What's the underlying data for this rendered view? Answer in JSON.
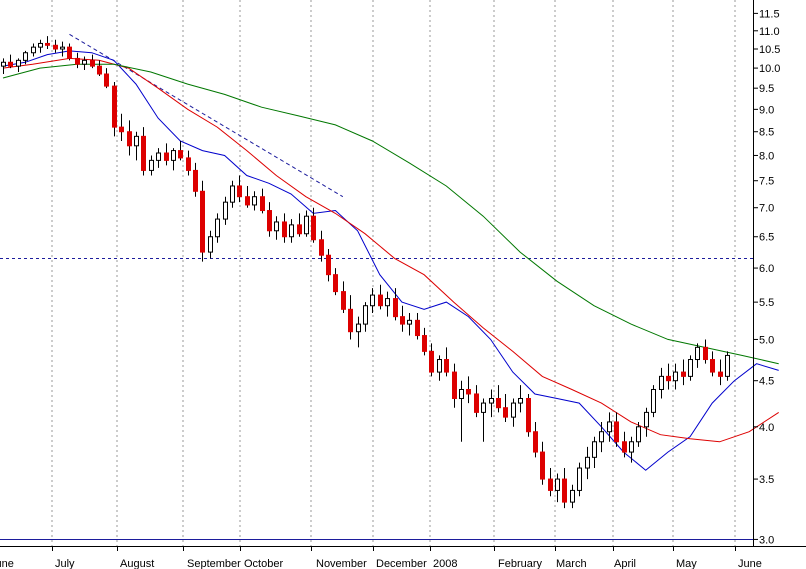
{
  "chart_data": {
    "type": "candlestick",
    "scale": "log",
    "ylim": [
      2.95,
      11.9
    ],
    "x_categories": [
      "June",
      "July",
      "August",
      "September",
      "October",
      "November",
      "December",
      "2008",
      "February",
      "March",
      "April",
      "May",
      "June"
    ],
    "y_ticks": [
      3.0,
      3.5,
      4.0,
      4.5,
      5.0,
      5.5,
      6.0,
      6.5,
      7.0,
      7.5,
      8.0,
      8.5,
      9.0,
      9.5,
      10.0,
      10.5,
      11.0,
      11.5
    ],
    "y_tick_labels": [
      "3.0",
      "3.5",
      "4.0",
      "4.5",
      "5.0",
      "5.5",
      "6.0",
      "6.5",
      "7.0",
      "7.5",
      "8.0",
      "8.5",
      "9.0",
      "9.5",
      "10.0",
      "10.5",
      "11.0",
      "11.5"
    ],
    "grid": "vertical dotted at month boundaries",
    "horizontal_lines": [
      {
        "value": 6.15,
        "style": "dashed",
        "color": "#1c1c9c"
      },
      {
        "value": 3.0,
        "style": "solid",
        "color": "#1c1c9c"
      }
    ],
    "trendline": {
      "style": "dashed",
      "color": "#1c1c9c",
      "from": {
        "day": 9,
        "value": 10.9
      },
      "to": {
        "day": 46,
        "value": 7.2
      }
    },
    "colors": {
      "up": "#ffffff",
      "down": "#dd0000",
      "wick": "#000000",
      "ma_short": "#0000cc",
      "ma_medium": "#dd0000",
      "ma_long": "#007700"
    },
    "series": [
      {
        "style": "line",
        "color": "#0000cc",
        "points": [
          [
            0,
            10.05
          ],
          [
            3,
            10.15
          ],
          [
            6,
            10.35
          ],
          [
            9,
            10.45
          ],
          [
            12,
            10.4
          ],
          [
            15,
            10.2
          ],
          [
            18,
            9.6
          ],
          [
            21,
            8.8
          ],
          [
            24,
            8.3
          ],
          [
            27,
            8.1
          ],
          [
            30,
            8.0
          ],
          [
            33,
            7.6
          ],
          [
            36,
            7.45
          ],
          [
            39,
            7.25
          ],
          [
            42,
            6.9
          ],
          [
            45,
            6.95
          ],
          [
            48,
            6.6
          ],
          [
            51,
            5.9
          ],
          [
            54,
            5.5
          ],
          [
            57,
            5.4
          ],
          [
            60,
            5.5
          ],
          [
            63,
            5.3
          ],
          [
            66,
            5.0
          ],
          [
            69,
            4.6
          ],
          [
            72,
            4.35
          ],
          [
            75,
            4.3
          ],
          [
            78,
            4.25
          ],
          [
            81,
            4.0
          ],
          [
            84,
            3.75
          ],
          [
            87,
            3.58
          ],
          [
            90,
            3.75
          ],
          [
            93,
            3.9
          ],
          [
            96,
            4.25
          ],
          [
            99,
            4.5
          ],
          [
            102,
            4.7
          ],
          [
            105,
            4.62
          ]
        ]
      },
      {
        "style": "line",
        "color": "#dd0000",
        "points": [
          [
            0,
            10.0
          ],
          [
            4,
            10.1
          ],
          [
            9,
            10.25
          ],
          [
            13,
            10.2
          ],
          [
            17,
            10.0
          ],
          [
            21,
            9.5
          ],
          [
            25,
            9.0
          ],
          [
            29,
            8.6
          ],
          [
            33,
            8.1
          ],
          [
            37,
            7.6
          ],
          [
            41,
            7.2
          ],
          [
            45,
            6.9
          ],
          [
            49,
            6.55
          ],
          [
            53,
            6.15
          ],
          [
            57,
            5.9
          ],
          [
            61,
            5.5
          ],
          [
            65,
            5.15
          ],
          [
            69,
            4.85
          ],
          [
            73,
            4.55
          ],
          [
            77,
            4.4
          ],
          [
            81,
            4.25
          ],
          [
            85,
            4.05
          ],
          [
            89,
            3.92
          ],
          [
            93,
            3.88
          ],
          [
            97,
            3.85
          ],
          [
            101,
            3.95
          ],
          [
            105,
            4.15
          ]
        ]
      },
      {
        "style": "line",
        "color": "#007700",
        "points": [
          [
            0,
            9.75
          ],
          [
            5,
            10.0
          ],
          [
            10,
            10.1
          ],
          [
            15,
            10.1
          ],
          [
            20,
            9.9
          ],
          [
            25,
            9.6
          ],
          [
            30,
            9.35
          ],
          [
            35,
            9.05
          ],
          [
            40,
            8.85
          ],
          [
            45,
            8.65
          ],
          [
            50,
            8.3
          ],
          [
            55,
            7.85
          ],
          [
            60,
            7.4
          ],
          [
            65,
            6.85
          ],
          [
            70,
            6.25
          ],
          [
            75,
            5.8
          ],
          [
            80,
            5.45
          ],
          [
            85,
            5.2
          ],
          [
            90,
            5.0
          ],
          [
            95,
            4.9
          ],
          [
            100,
            4.8
          ],
          [
            105,
            4.7
          ]
        ]
      }
    ],
    "candles": [
      [
        10.05,
        10.25,
        9.85,
        10.15
      ],
      [
        10.15,
        10.35,
        10.0,
        10.05
      ],
      [
        10.05,
        10.25,
        9.9,
        10.2
      ],
      [
        10.2,
        10.45,
        10.1,
        10.4
      ],
      [
        10.4,
        10.65,
        10.3,
        10.55
      ],
      [
        10.55,
        10.75,
        10.4,
        10.65
      ],
      [
        10.65,
        10.85,
        10.5,
        10.6
      ],
      [
        10.6,
        10.75,
        10.4,
        10.5
      ],
      [
        10.5,
        10.7,
        10.3,
        10.55
      ],
      [
        10.55,
        10.65,
        10.2,
        10.25
      ],
      [
        10.25,
        10.4,
        10.0,
        10.1
      ],
      [
        10.1,
        10.3,
        9.95,
        10.2
      ],
      [
        10.2,
        10.35,
        10.0,
        10.05
      ],
      [
        10.05,
        10.2,
        9.8,
        9.85
      ],
      [
        9.85,
        10.0,
        9.5,
        9.55
      ],
      [
        9.55,
        9.65,
        8.4,
        8.6
      ],
      [
        8.6,
        8.9,
        8.3,
        8.5
      ],
      [
        8.5,
        8.75,
        8.0,
        8.2
      ],
      [
        8.2,
        8.5,
        7.9,
        8.4
      ],
      [
        8.4,
        8.6,
        7.6,
        7.7
      ],
      [
        7.7,
        8.0,
        7.6,
        7.9
      ],
      [
        7.9,
        8.15,
        7.75,
        8.05
      ],
      [
        8.05,
        8.25,
        7.8,
        7.9
      ],
      [
        7.9,
        8.15,
        7.7,
        8.1
      ],
      [
        8.1,
        8.3,
        7.9,
        7.95
      ],
      [
        7.95,
        8.1,
        7.6,
        7.7
      ],
      [
        7.7,
        7.85,
        7.2,
        7.3
      ],
      [
        7.3,
        7.5,
        6.1,
        6.25
      ],
      [
        6.25,
        6.6,
        6.15,
        6.5
      ],
      [
        6.5,
        6.9,
        6.4,
        6.8
      ],
      [
        6.8,
        7.2,
        6.7,
        7.1
      ],
      [
        7.1,
        7.5,
        7.0,
        7.4
      ],
      [
        7.4,
        7.6,
        7.1,
        7.2
      ],
      [
        7.2,
        7.4,
        7.0,
        7.05
      ],
      [
        7.05,
        7.3,
        6.95,
        7.2
      ],
      [
        7.2,
        7.35,
        6.9,
        6.95
      ],
      [
        6.95,
        7.1,
        6.5,
        6.6
      ],
      [
        6.6,
        6.85,
        6.45,
        6.75
      ],
      [
        6.75,
        6.9,
        6.4,
        6.5
      ],
      [
        6.5,
        6.8,
        6.4,
        6.7
      ],
      [
        6.7,
        6.9,
        6.5,
        6.55
      ],
      [
        6.55,
        6.95,
        6.5,
        6.85
      ],
      [
        6.85,
        7.0,
        6.4,
        6.45
      ],
      [
        6.45,
        6.6,
        6.1,
        6.2
      ],
      [
        6.2,
        6.3,
        5.8,
        5.9
      ],
      [
        5.9,
        6.0,
        5.6,
        5.65
      ],
      [
        5.65,
        5.8,
        5.35,
        5.4
      ],
      [
        5.4,
        5.6,
        5.0,
        5.1
      ],
      [
        5.1,
        5.3,
        4.9,
        5.2
      ],
      [
        5.2,
        5.5,
        5.1,
        5.45
      ],
      [
        5.45,
        5.7,
        5.35,
        5.6
      ],
      [
        5.6,
        5.75,
        5.4,
        5.45
      ],
      [
        5.45,
        5.65,
        5.3,
        5.55
      ],
      [
        5.55,
        5.7,
        5.25,
        5.3
      ],
      [
        5.3,
        5.45,
        5.1,
        5.2
      ],
      [
        5.2,
        5.35,
        5.05,
        5.25
      ],
      [
        5.25,
        5.35,
        5.0,
        5.05
      ],
      [
        5.05,
        5.15,
        4.8,
        4.85
      ],
      [
        4.85,
        4.95,
        4.55,
        4.6
      ],
      [
        4.6,
        4.8,
        4.5,
        4.75
      ],
      [
        4.75,
        4.9,
        4.55,
        4.6
      ],
      [
        4.6,
        4.7,
        4.2,
        4.3
      ],
      [
        4.3,
        4.5,
        3.85,
        4.4
      ],
      [
        4.4,
        4.55,
        4.25,
        4.35
      ],
      [
        4.35,
        4.45,
        4.1,
        4.15
      ],
      [
        4.15,
        4.3,
        3.85,
        4.25
      ],
      [
        4.25,
        4.4,
        4.1,
        4.3
      ],
      [
        4.3,
        4.45,
        4.15,
        4.2
      ],
      [
        4.2,
        4.35,
        4.05,
        4.1
      ],
      [
        4.1,
        4.3,
        4.0,
        4.25
      ],
      [
        4.25,
        4.45,
        4.15,
        4.3
      ],
      [
        4.3,
        4.35,
        3.9,
        3.95
      ],
      [
        3.95,
        4.05,
        3.7,
        3.75
      ],
      [
        3.75,
        3.85,
        3.45,
        3.5
      ],
      [
        3.5,
        3.6,
        3.35,
        3.4
      ],
      [
        3.4,
        3.55,
        3.3,
        3.5
      ],
      [
        3.5,
        3.6,
        3.25,
        3.3
      ],
      [
        3.3,
        3.45,
        3.25,
        3.4
      ],
      [
        3.4,
        3.65,
        3.35,
        3.6
      ],
      [
        3.6,
        3.8,
        3.5,
        3.7
      ],
      [
        3.7,
        3.9,
        3.6,
        3.85
      ],
      [
        3.85,
        4.05,
        3.75,
        3.95
      ],
      [
        3.95,
        4.15,
        3.85,
        4.05
      ],
      [
        4.05,
        4.15,
        3.8,
        3.85
      ],
      [
        3.85,
        3.95,
        3.7,
        3.75
      ],
      [
        3.75,
        3.9,
        3.65,
        3.85
      ],
      [
        3.85,
        4.05,
        3.8,
        4.0
      ],
      [
        4.0,
        4.2,
        3.9,
        4.15
      ],
      [
        4.15,
        4.45,
        4.1,
        4.4
      ],
      [
        4.4,
        4.65,
        4.3,
        4.55
      ],
      [
        4.55,
        4.7,
        4.4,
        4.5
      ],
      [
        4.5,
        4.7,
        4.4,
        4.6
      ],
      [
        4.6,
        4.75,
        4.45,
        4.55
      ],
      [
        4.55,
        4.8,
        4.5,
        4.75
      ],
      [
        4.75,
        4.95,
        4.65,
        4.9
      ],
      [
        4.9,
        5.0,
        4.7,
        4.75
      ],
      [
        4.75,
        4.85,
        4.55,
        4.6
      ],
      [
        4.6,
        4.75,
        4.45,
        4.55
      ],
      [
        4.55,
        4.85,
        4.5,
        4.8
      ]
    ]
  }
}
